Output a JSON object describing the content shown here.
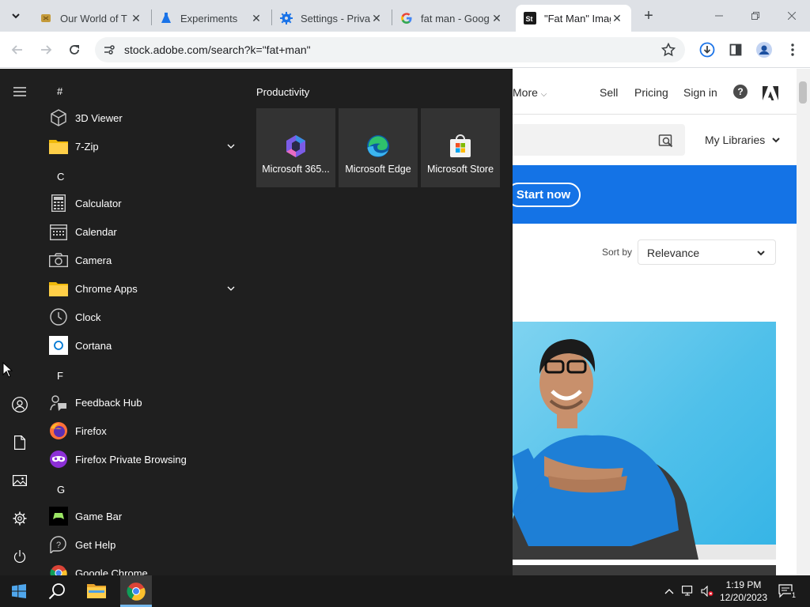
{
  "browser": {
    "tabs": [
      {
        "title": "Our World of T",
        "favicon": "game-icon"
      },
      {
        "title": "Experiments",
        "favicon": "flask-icon"
      },
      {
        "title": "Settings - Priva",
        "favicon": "gear-icon"
      },
      {
        "title": "fat man - Goog",
        "favicon": "google-icon"
      },
      {
        "title": "\"Fat Man\" Imag",
        "favicon": "adobe-stock-icon",
        "active": true
      }
    ],
    "url": "stock.adobe.com/search?k=\"fat+man\""
  },
  "webpage": {
    "nav": {
      "more": "More",
      "sell": "Sell",
      "pricing": "Pricing",
      "sign_in": "Sign in"
    },
    "my_libraries": "My Libraries",
    "banner_button": "Start now",
    "sort_label": "Sort by",
    "sort_value": "Relevance",
    "accent_color": "#1473e6"
  },
  "start_menu": {
    "letters": {
      "hash": "#",
      "c": "C",
      "f": "F",
      "g": "G"
    },
    "apps": [
      {
        "name": "3D Viewer",
        "icon": "cube-icon"
      },
      {
        "name": "7-Zip",
        "icon": "folder-icon",
        "expandable": true
      },
      {
        "name": "Calculator",
        "icon": "calculator-icon"
      },
      {
        "name": "Calendar",
        "icon": "calendar-icon"
      },
      {
        "name": "Camera",
        "icon": "camera-icon"
      },
      {
        "name": "Chrome Apps",
        "icon": "folder-icon",
        "expandable": true
      },
      {
        "name": "Clock",
        "icon": "clock-icon"
      },
      {
        "name": "Cortana",
        "icon": "cortana-icon"
      },
      {
        "name": "Feedback Hub",
        "icon": "feedback-icon"
      },
      {
        "name": "Firefox",
        "icon": "firefox-icon"
      },
      {
        "name": "Firefox Private Browsing",
        "icon": "firefox-private-icon"
      },
      {
        "name": "Game Bar",
        "icon": "xbox-icon"
      },
      {
        "name": "Get Help",
        "icon": "help-icon"
      },
      {
        "name": "Google Chrome",
        "icon": "chrome-icon"
      }
    ],
    "group_title": "Productivity",
    "tiles": [
      {
        "name": "Microsoft 365...",
        "icon": "m365-icon"
      },
      {
        "name": "Microsoft Edge",
        "icon": "edge-icon"
      },
      {
        "name": "Microsoft Store",
        "icon": "store-icon"
      }
    ]
  },
  "taskbar": {
    "time": "1:19 PM",
    "date": "12/20/2023",
    "notification_count": "1"
  }
}
